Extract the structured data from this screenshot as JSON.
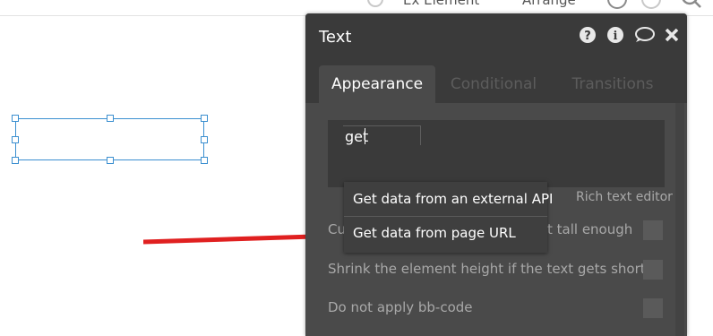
{
  "topbar": {
    "text_left": "Ex Element",
    "text_right": "Arrange"
  },
  "panel": {
    "title": "Text",
    "header_icons": [
      "help-icon",
      "info-icon",
      "comment-icon",
      "close-icon"
    ],
    "tabs": [
      {
        "label": "Appearance",
        "active": true
      },
      {
        "label": "Conditional",
        "active": false
      },
      {
        "label": "Transitions",
        "active": false
      }
    ],
    "text_value": "get",
    "rich_text_editor_label": "Rich text editor",
    "options": [
      {
        "label": "Cu",
        "label_tail": "t tall enough"
      },
      {
        "label": "Shrink the element height if the text gets shorter"
      },
      {
        "label": "Do not apply bb-code"
      }
    ]
  },
  "autocomplete": {
    "items": [
      "Get data from an external API",
      "Get data from page URL"
    ]
  },
  "colors": {
    "panel_bg": "#4a4a4a",
    "header_bg": "#3a3a3a",
    "selection": "#3b8fd0",
    "arrow": "#e02020"
  }
}
